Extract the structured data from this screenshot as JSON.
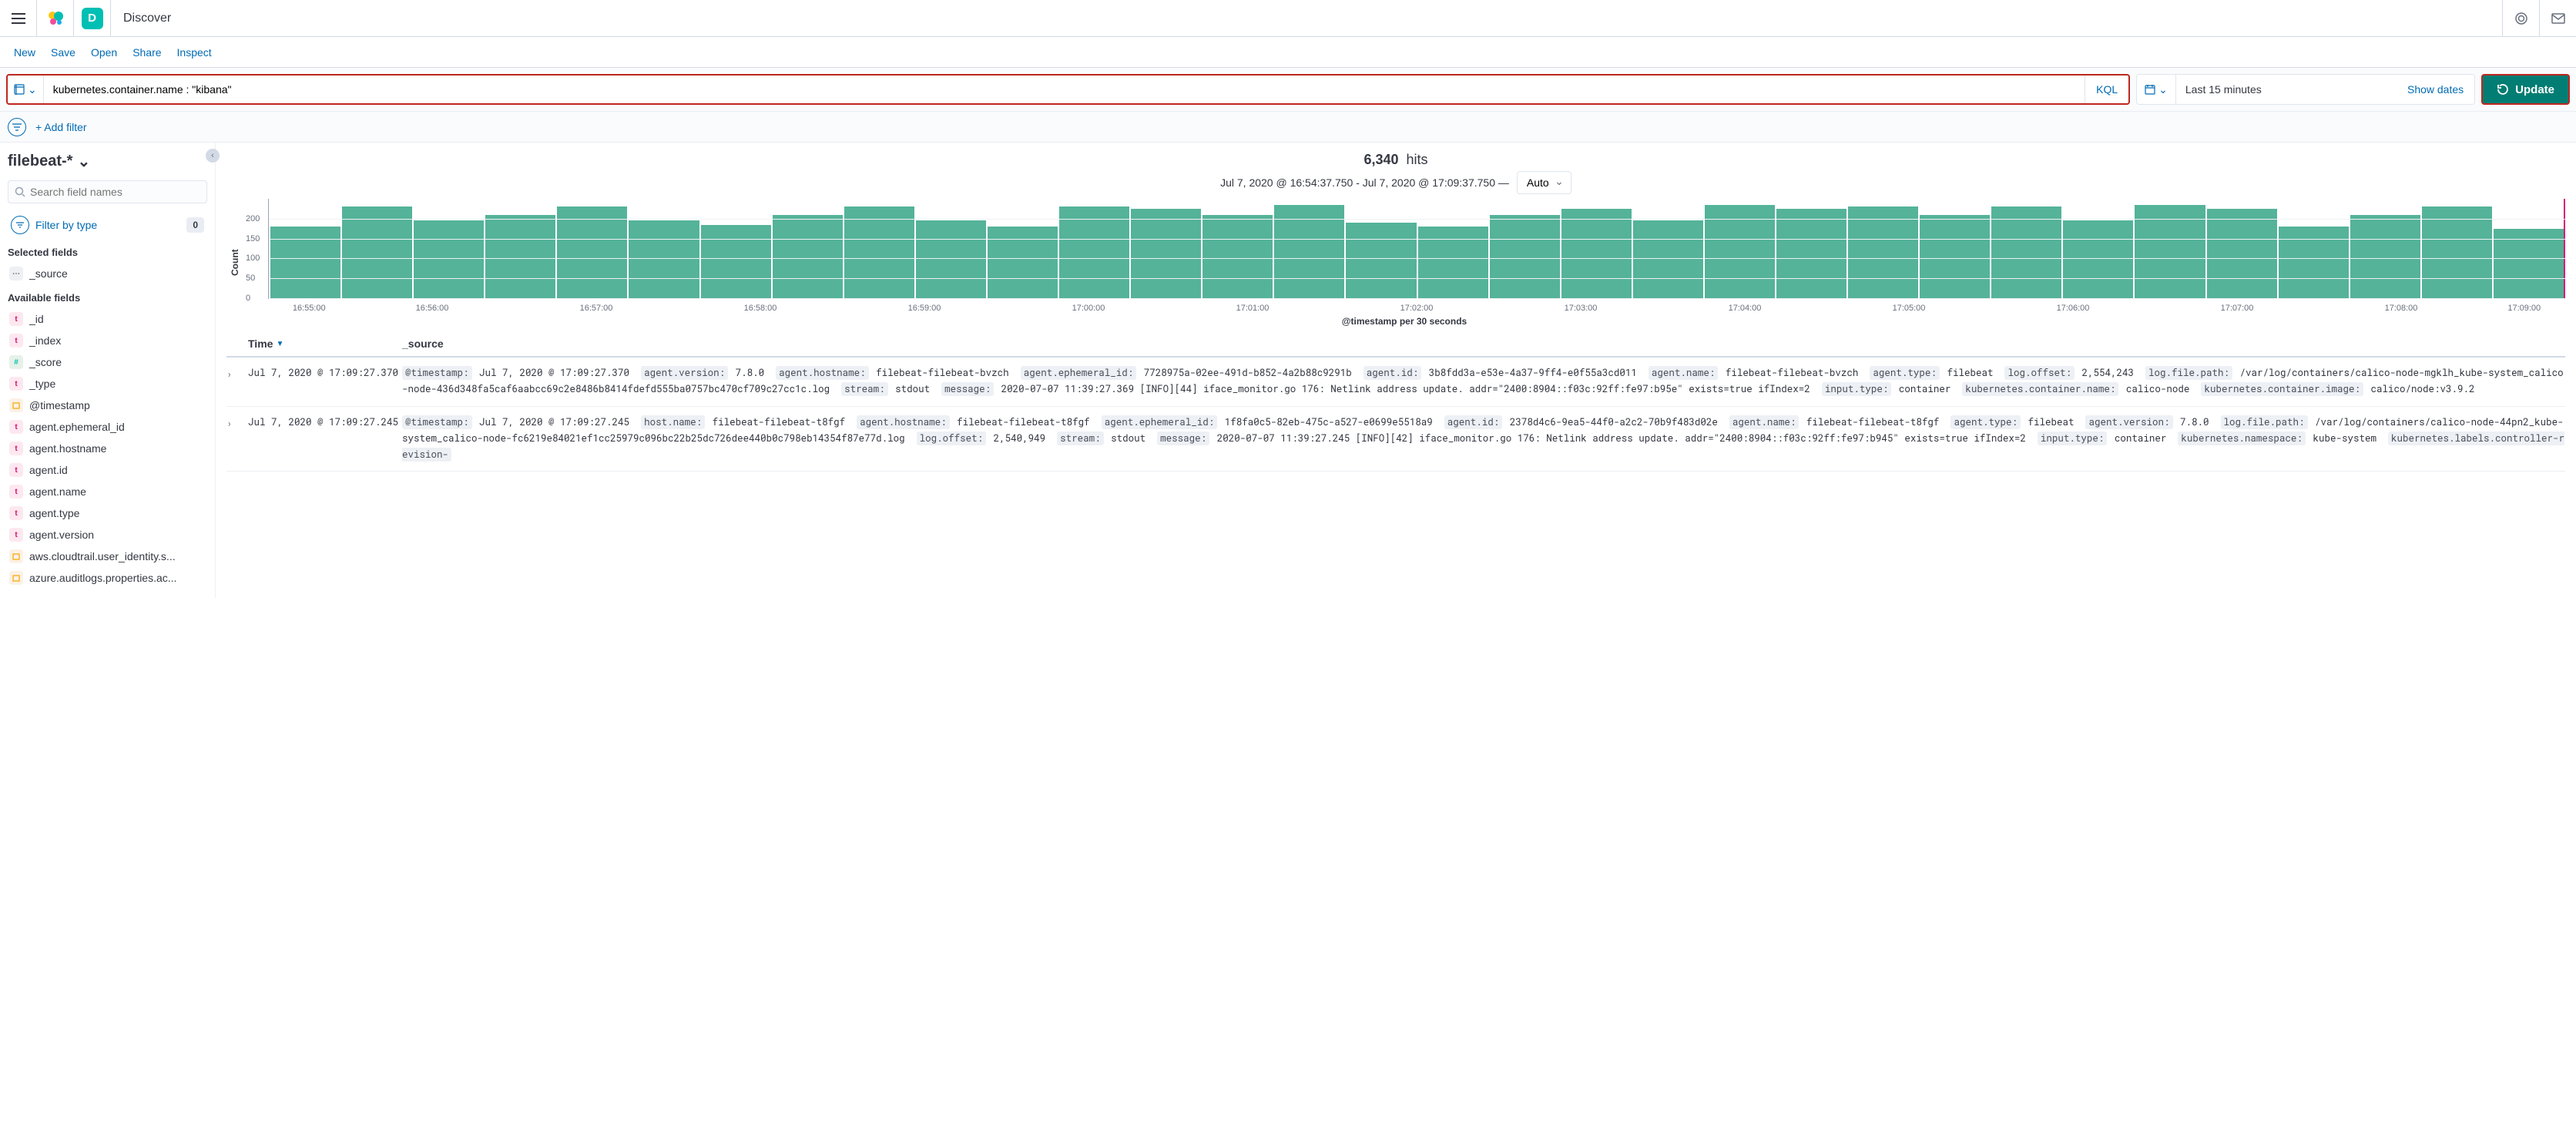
{
  "header": {
    "app_letter": "D",
    "title": "Discover"
  },
  "menu": {
    "new": "New",
    "save": "Save",
    "open": "Open",
    "share": "Share",
    "inspect": "Inspect"
  },
  "query": {
    "value": "kubernetes.container.name : \"kibana\"",
    "kql": "KQL"
  },
  "datepicker": {
    "label": "Last 15 minutes",
    "show_dates": "Show dates"
  },
  "update_btn": "Update",
  "filterbar": {
    "add": "+ Add filter"
  },
  "sidebar": {
    "index": "filebeat-*",
    "search_placeholder": "Search field names",
    "filter_by_type": "Filter by type",
    "filter_count": "0",
    "selected_h": "Selected fields",
    "available_h": "Available fields",
    "selected": [
      {
        "type": "s",
        "label": "_source"
      }
    ],
    "available": [
      {
        "type": "t",
        "label": "_id"
      },
      {
        "type": "t",
        "label": "_index"
      },
      {
        "type": "n",
        "label": "_score"
      },
      {
        "type": "t",
        "label": "_type"
      },
      {
        "type": "d",
        "label": "@timestamp"
      },
      {
        "type": "t",
        "label": "agent.ephemeral_id"
      },
      {
        "type": "t",
        "label": "agent.hostname"
      },
      {
        "type": "t",
        "label": "agent.id"
      },
      {
        "type": "t",
        "label": "agent.name"
      },
      {
        "type": "t",
        "label": "agent.type"
      },
      {
        "type": "t",
        "label": "agent.version"
      },
      {
        "type": "d",
        "label": "aws.cloudtrail.user_identity.s..."
      },
      {
        "type": "d",
        "label": "azure.auditlogs.properties.ac..."
      }
    ]
  },
  "hits": {
    "count": "6,340",
    "label": "hits"
  },
  "range": "Jul 7, 2020 @ 16:54:37.750 - Jul 7, 2020 @ 17:09:37.750 —",
  "interval": "Auto",
  "chart_data": {
    "type": "bar",
    "ylabel": "Count",
    "xlabel": "@timestamp per 30 seconds",
    "ylim": [
      0,
      250
    ],
    "yticks": [
      0,
      50,
      100,
      150,
      200
    ],
    "categories": [
      "16:55:00",
      "16:56:00",
      "16:57:00",
      "16:58:00",
      "16:59:00",
      "17:00:00",
      "17:01:00",
      "17:02:00",
      "17:03:00",
      "17:04:00",
      "17:05:00",
      "17:06:00",
      "17:07:00",
      "17:08:00",
      "17:09:00"
    ],
    "values": [
      180,
      230,
      195,
      210,
      230,
      195,
      185,
      210,
      230,
      195,
      180,
      230,
      225,
      210,
      235,
      190,
      180,
      210,
      225,
      195,
      235,
      225,
      230,
      210,
      230,
      195,
      235,
      225,
      180,
      210,
      230,
      175
    ]
  },
  "table": {
    "time_h": "Time",
    "source_h": "_source",
    "rows": [
      {
        "time": "Jul 7, 2020 @ 17:09:27.370",
        "kv": [
          [
            "@timestamp:",
            "Jul 7, 2020 @ 17:09:27.370"
          ],
          [
            "agent.version:",
            "7.8.0"
          ],
          [
            "agent.hostname:",
            "filebeat-filebeat-bvzch"
          ],
          [
            "agent.ephemeral_id:",
            "7728975a-02ee-491d-b852-4a2b88c9291b"
          ],
          [
            "agent.id:",
            "3b8fdd3a-e53e-4a37-9ff4-e0f55a3cd011"
          ],
          [
            "agent.name:",
            "filebeat-filebeat-bvzch"
          ],
          [
            "agent.type:",
            "filebeat"
          ],
          [
            "log.offset:",
            "2,554,243"
          ],
          [
            "log.file.path:",
            "/var/log/containers/calico-node-mgklh_kube-system_calico-node-436d348fa5caf6aabcc69c2e8486b8414fdefd555ba0757bc470cf709c27cc1c.log"
          ],
          [
            "stream:",
            "stdout"
          ],
          [
            "message:",
            "2020-07-07 11:39:27.369 [INFO][44] iface_monitor.go 176: Netlink address update. addr=\"2400:8904::f03c:92ff:fe97:b95e\" exists=true ifIndex=2"
          ],
          [
            "input.type:",
            "container"
          ],
          [
            "kubernetes.container.name:",
            "calico-node"
          ],
          [
            "kubernetes.container.image:",
            "calico/node:v3.9.2"
          ]
        ]
      },
      {
        "time": "Jul 7, 2020 @ 17:09:27.245",
        "kv": [
          [
            "@timestamp:",
            "Jul 7, 2020 @ 17:09:27.245"
          ],
          [
            "host.name:",
            "filebeat-filebeat-t8fgf"
          ],
          [
            "agent.hostname:",
            "filebeat-filebeat-t8fgf"
          ],
          [
            "agent.ephemeral_id:",
            "1f8fa0c5-82eb-475c-a527-e0699e5518a9"
          ],
          [
            "agent.id:",
            "2378d4c6-9ea5-44f0-a2c2-70b9f483d02e"
          ],
          [
            "agent.name:",
            "filebeat-filebeat-t8fgf"
          ],
          [
            "agent.type:",
            "filebeat"
          ],
          [
            "agent.version:",
            "7.8.0"
          ],
          [
            "log.file.path:",
            "/var/log/containers/calico-node-44pn2_kube-system_calico-node-fc6219e84021ef1cc25979c096bc22b25dc726dee440b0c798eb14354f87e77d.log"
          ],
          [
            "log.offset:",
            "2,540,949"
          ],
          [
            "stream:",
            "stdout"
          ],
          [
            "message:",
            "2020-07-07 11:39:27.245 [INFO][42] iface_monitor.go 176: Netlink address update. addr=\"2400:8904::f03c:92ff:fe97:b945\" exists=true ifIndex=2"
          ],
          [
            "input.type:",
            "container"
          ],
          [
            "kubernetes.namespace:",
            "kube-system"
          ],
          [
            "kubernetes.labels.controller-revision-",
            ""
          ]
        ]
      }
    ]
  }
}
